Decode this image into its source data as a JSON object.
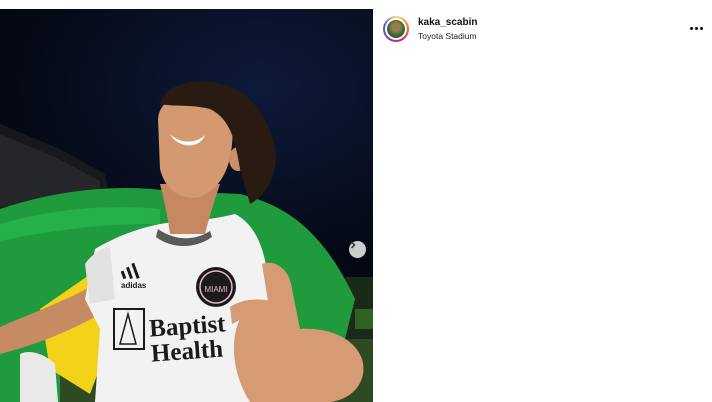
{
  "post": {
    "username": "kaka_scabin",
    "location": "Toyota Stadium"
  },
  "photo": {
    "jersey_sponsor_line1": "Baptist",
    "jersey_sponsor_line2": "Health",
    "jersey_brand": "adidas",
    "crest_text": "MIAMI"
  },
  "icons": {
    "more": "more-options-icon",
    "next": "chevron-right-icon"
  },
  "colors": {
    "flag_green": "#1f9a3c",
    "flag_yellow": "#f3d21a",
    "jersey": "#f2f2f2",
    "night_sky": "#050914",
    "avatar_ring": "#d62976"
  }
}
